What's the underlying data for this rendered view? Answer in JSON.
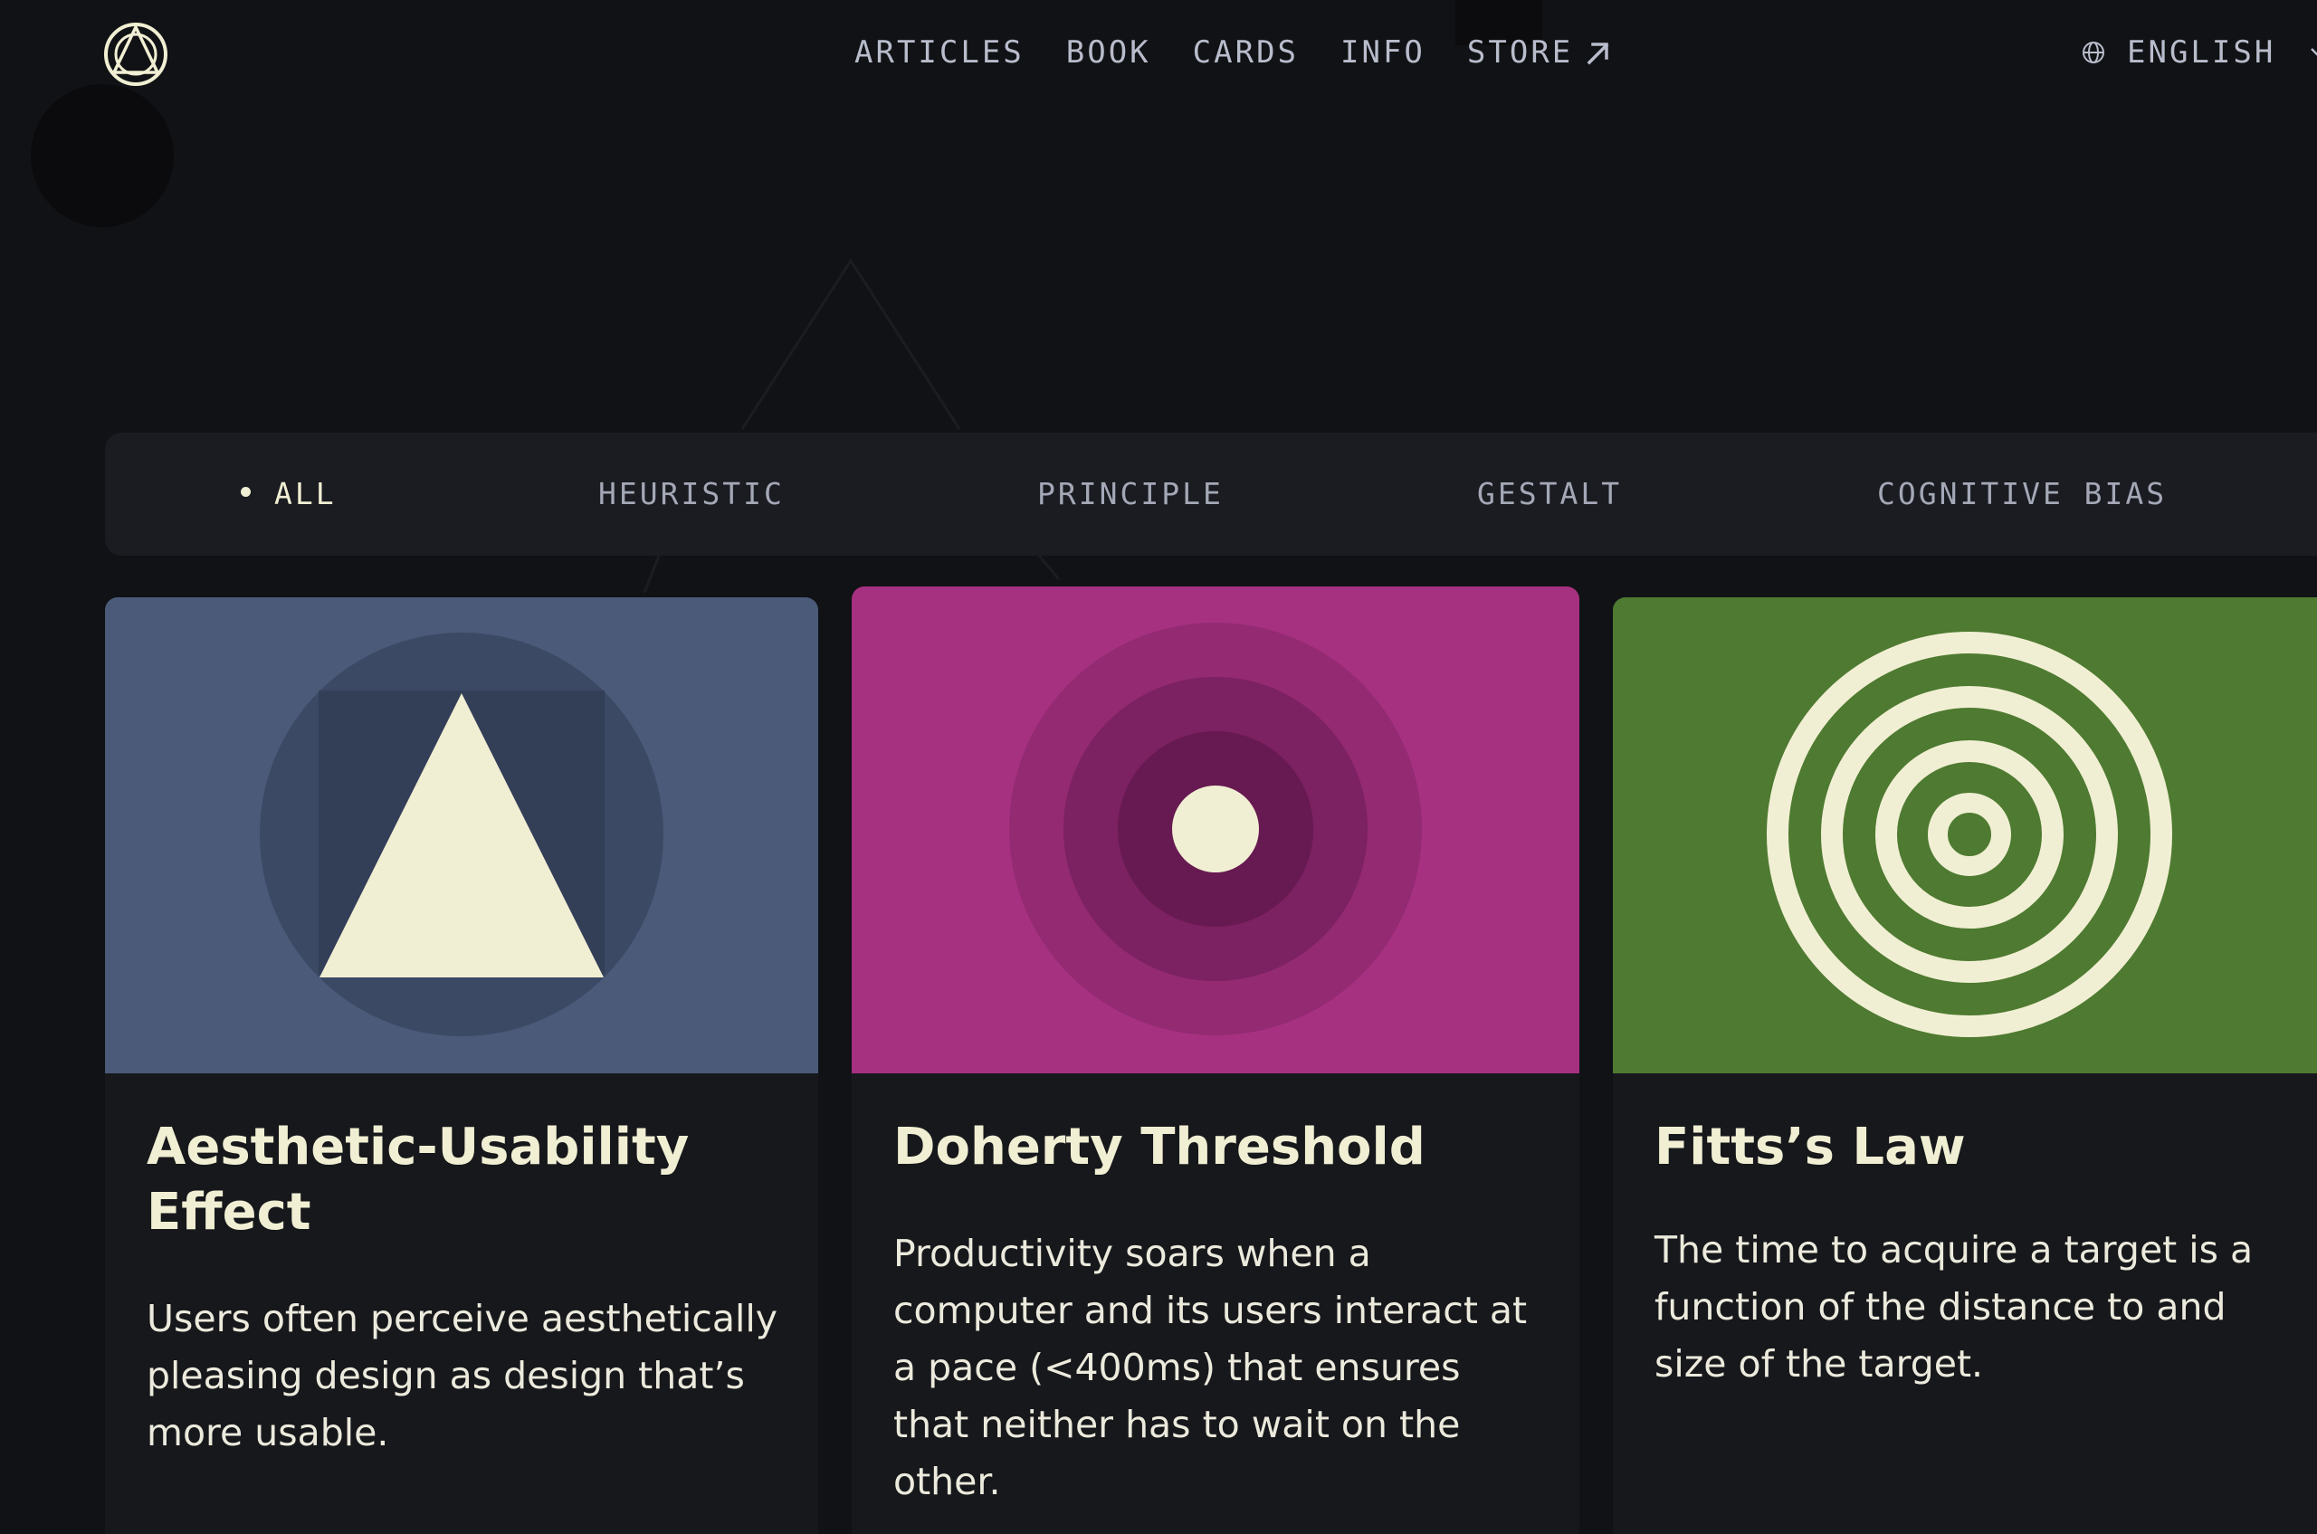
{
  "nav": {
    "items": [
      {
        "label": "ARTICLES"
      },
      {
        "label": "BOOK"
      },
      {
        "label": "CARDS"
      },
      {
        "label": "INFO"
      },
      {
        "label": "STORE"
      }
    ],
    "language": "ENGLISH"
  },
  "filters": [
    {
      "label": "ALL",
      "active": true
    },
    {
      "label": "HEURISTIC",
      "active": false
    },
    {
      "label": "PRINCIPLE",
      "active": false
    },
    {
      "label": "GESTALT",
      "active": false
    },
    {
      "label": "COGNITIVE BIAS",
      "active": false
    }
  ],
  "cards": [
    {
      "title_line1": "Aesthetic-Usability",
      "title_line2": "Effect",
      "desc_line1": "Users often perceive aesthetically",
      "desc_line2": "pleasing design as design that’s",
      "desc_line3": "more usable.",
      "color": "#4a5a78",
      "icon": "triangle-icon"
    },
    {
      "title_line1": "Doherty Threshold",
      "desc_line1": "Productivity soars when a",
      "desc_line2": "computer and its users interact at",
      "desc_line3": "a pace (<400ms) that ensures",
      "desc_line4": "that neither has to wait on the",
      "desc_line5": "other.",
      "color": "#a63181",
      "icon": "concentric-circles-icon"
    },
    {
      "title_line1": "Fitts’s Law",
      "desc_line1": "The time to acquire a target is a",
      "desc_line2": "function of the distance to and",
      "desc_line3": "size of the target.",
      "color": "#4e7a31",
      "icon": "target-icon"
    }
  ],
  "colors": {
    "background": "#111215",
    "text": "#f1efd3",
    "nav_text": "#b8bccb",
    "filter_bar": "#1a1c21",
    "card_body": "#17181c"
  }
}
